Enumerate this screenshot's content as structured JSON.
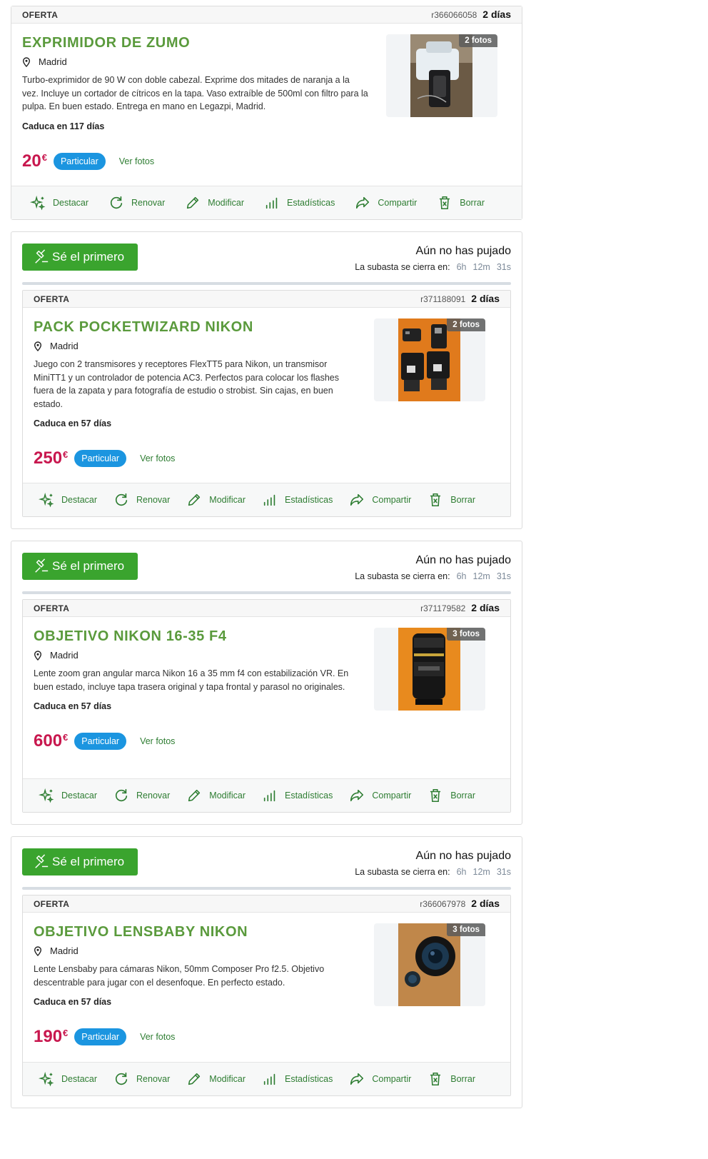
{
  "common": {
    "kind": "OFERTA",
    "age": "2 días",
    "location": "Madrid",
    "seller_type": "Particular",
    "see_photos": "Ver fotos",
    "currency": "€",
    "actions": {
      "highlight": "Destacar",
      "renew": "Renovar",
      "edit": "Modificar",
      "stats": "Estadísticas",
      "share": "Compartir",
      "delete": "Borrar"
    }
  },
  "auction": {
    "button": "Sé el primero",
    "status": "Aún no has pujado",
    "closes_label": "La subasta se cierra en:",
    "hours": "6h",
    "minutes": "12m",
    "seconds": "31s"
  },
  "ads": [
    {
      "ref": "r366066058",
      "title": "EXPRIMIDOR DE ZUMO",
      "description": "Turbo-exprimidor de 90 W con doble cabezal. Exprime dos mitades de naranja a la vez. Incluye un cortador de cítricos en la tapa. Vaso extraíble de 500ml con filtro para la pulpa. En buen estado. Entrega en mano en Legazpi, Madrid.",
      "expiry": "Caduca en 117 días",
      "price": "20",
      "photos": "2 fotos"
    },
    {
      "ref": "r371188091",
      "title": "PACK POCKETWIZARD NIKON",
      "description": "Juego con 2 transmisores y receptores FlexTT5 para Nikon, un transmisor MiniTT1 y un controlador de potencia AC3. Perfectos para colocar los flashes fuera de la zapata y para fotografía de estudio o strobist. Sin cajas, en buen estado.",
      "expiry": "Caduca en 57 días",
      "price": "250",
      "photos": "2 fotos"
    },
    {
      "ref": "r371179582",
      "title": "OBJETIVO NIKON 16-35 F4",
      "description": "Lente zoom gran angular marca Nikon 16 a 35 mm f4 con estabilización VR. En buen estado, incluye tapa trasera original y tapa frontal y parasol no originales.",
      "expiry": "Caduca en 57 días",
      "price": "600",
      "photos": "3 fotos"
    },
    {
      "ref": "r366067978",
      "title": "OBJETIVO LENSBABY NIKON",
      "description": "Lente Lensbaby para cámaras Nikon, 50mm Composer Pro f2.5. Objetivo descentrable para jugar con el desenfoque. En perfecto estado.",
      "expiry": "Caduca en 57 días",
      "price": "190",
      "photos": "3 fotos"
    }
  ]
}
